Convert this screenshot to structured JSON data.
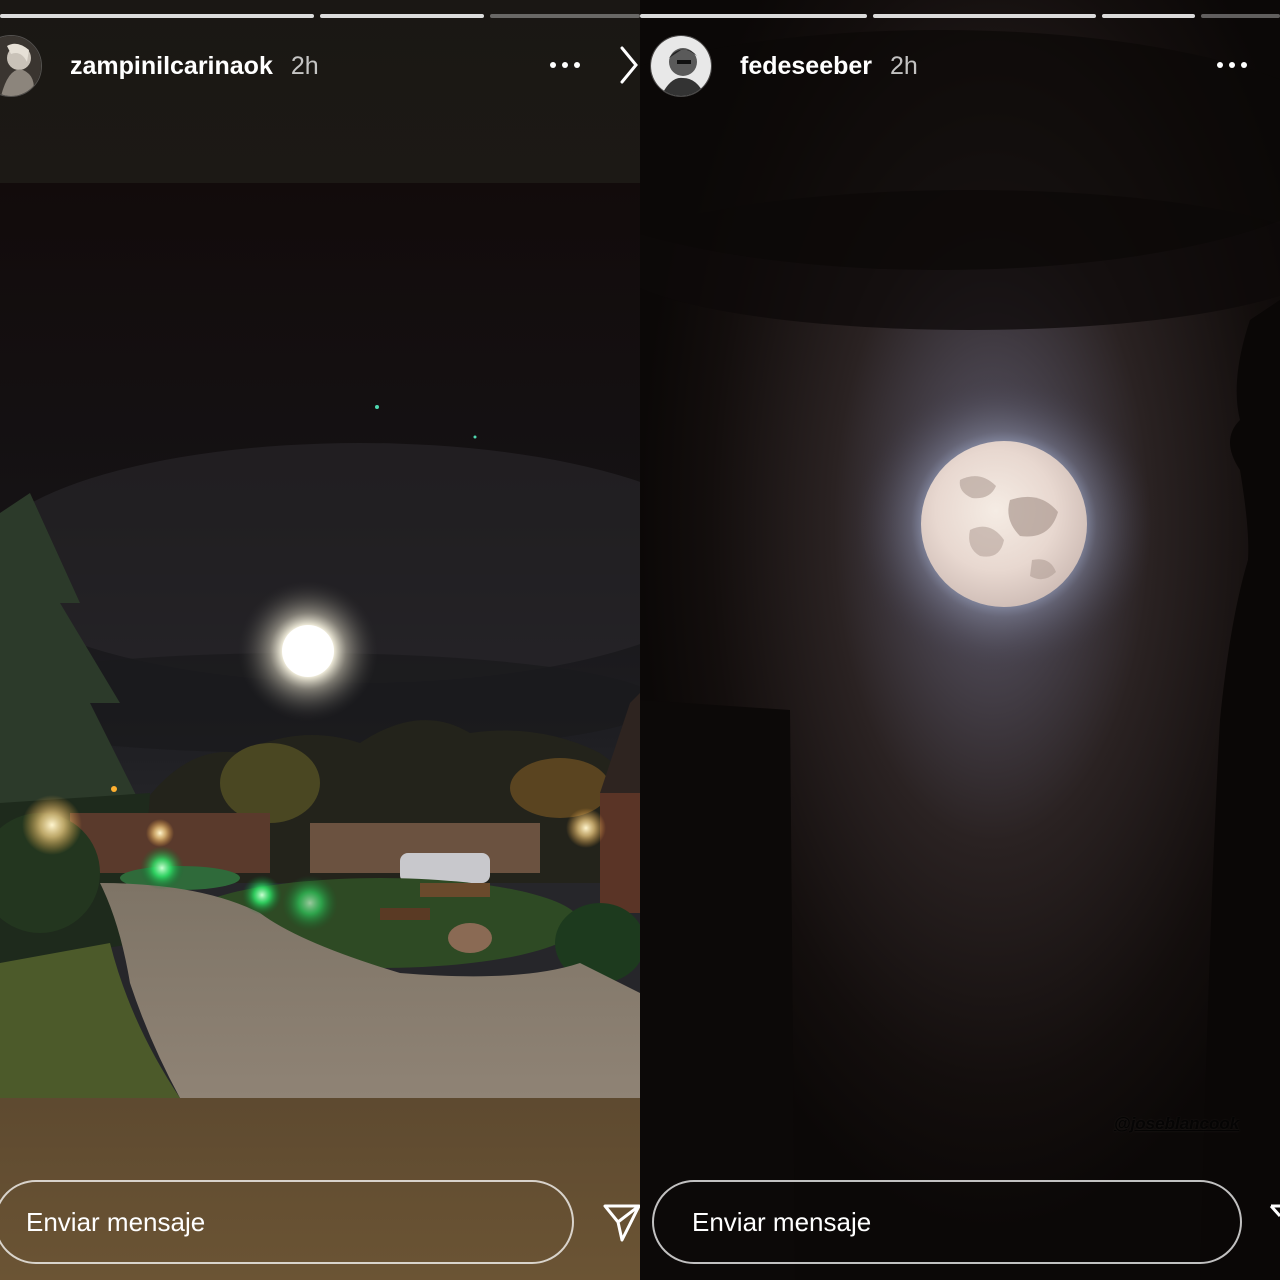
{
  "stories": [
    {
      "username": "zampinilcarinaok",
      "time": "2h",
      "message_placeholder": "Enviar mensaje",
      "progress": {
        "segments": 3,
        "completed": 2
      }
    },
    {
      "username": "fedeseeber",
      "time": "2h",
      "message_placeholder": "Enviar mensaje",
      "photo_credit": "@joseblancook",
      "progress": {
        "segments": 4,
        "completed": 3
      }
    }
  ],
  "icons": {
    "more": "more-horizontal-icon",
    "next": "chevron-right-icon",
    "send": "paper-plane-icon"
  },
  "colors": {
    "text": "#ffffff",
    "progress_done": "#ffffffd9",
    "progress_pending": "#ffffff59"
  }
}
